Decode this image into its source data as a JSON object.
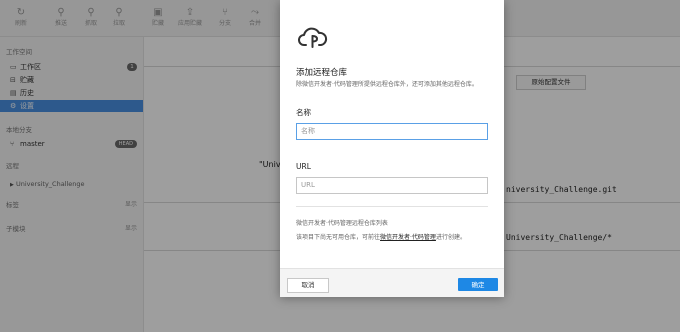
{
  "toolbar": {
    "items": [
      {
        "label": "刷新",
        "icon": "refresh-icon"
      },
      {
        "label": "推送",
        "icon": "push-icon"
      },
      {
        "label": "抓取",
        "icon": "fetch-icon"
      },
      {
        "label": "拉取",
        "icon": "pull-icon"
      },
      {
        "label": "贮藏",
        "icon": "stash-icon"
      },
      {
        "label": "应用贮藏",
        "icon": "apply-stash-icon"
      },
      {
        "label": "分支",
        "icon": "branch-icon"
      },
      {
        "label": "合并",
        "icon": "merge-icon"
      }
    ]
  },
  "sidebar": {
    "workspace_header": "工作空间",
    "workspace_items": [
      {
        "label": "工作区",
        "badge": "1",
        "icon": "workspace-icon"
      },
      {
        "label": "贮藏",
        "icon": "stash-icon"
      },
      {
        "label": "历史",
        "icon": "history-icon"
      },
      {
        "label": "设置",
        "icon": "settings-icon",
        "selected": true
      }
    ],
    "local_branches_header": "本地分支",
    "branch": {
      "name": "master",
      "badge": "HEAD"
    },
    "remote_header": "远程",
    "remote_item": "University_Challenge",
    "tags_header": "标签",
    "tags_show": "显示",
    "submodules_header": "子模块",
    "submodules_show": "显示"
  },
  "background": {
    "config_button": "原始配置文件",
    "quote_fragment": "\"Univ",
    "url_fragment": "niversity_Challenge.git",
    "refspec_fragment": "University_Challenge/*"
  },
  "modal": {
    "title": "添加远程仓库",
    "description": "除微信开发者·代码管理所提供远程仓库外，还可添加其他远程仓库。",
    "name_label": "名称",
    "name_placeholder": "名称",
    "url_label": "URL",
    "url_placeholder": "URL",
    "sub_heading": "微信开发者·代码管理远程仓库列表",
    "note_prefix": "该项目下尚无可用仓库，可前往",
    "note_link": "微信开发者·代码管理",
    "note_suffix": "进行创建。",
    "cancel": "取消",
    "confirm": "确定",
    "accent_color": "#1e88e5"
  }
}
